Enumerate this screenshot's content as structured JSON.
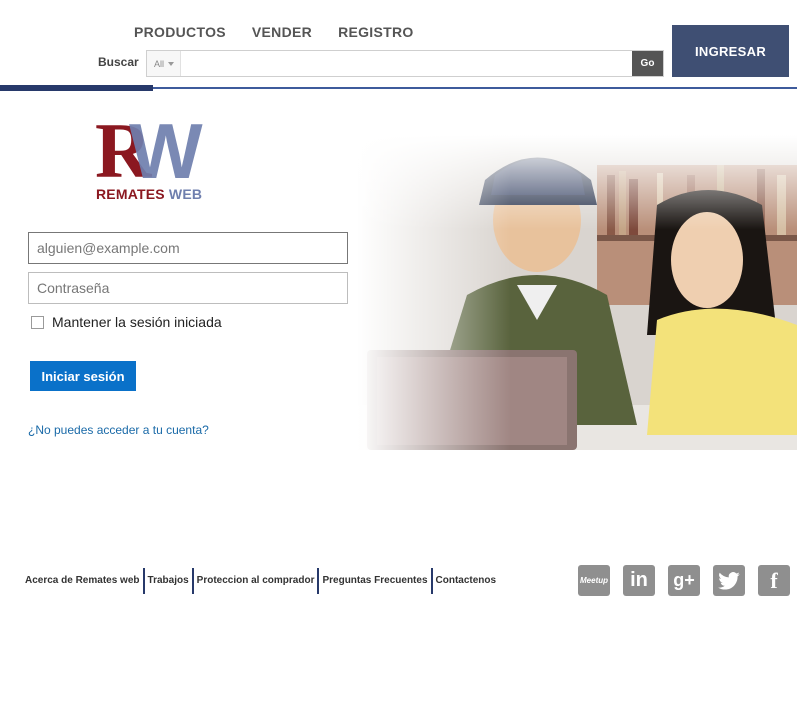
{
  "nav": {
    "items": [
      {
        "label": "PRODUCTOS"
      },
      {
        "label": "VENDER"
      },
      {
        "label": "REGISTRO"
      }
    ]
  },
  "search": {
    "label": "Buscar",
    "category": "All",
    "value": "",
    "go_label": "Go"
  },
  "header": {
    "login_button": "INGRESAR"
  },
  "logo": {
    "letter_r": "R",
    "letter_w": "W",
    "brand_1": "REMATES",
    "brand_2": " WEB"
  },
  "login": {
    "email_placeholder": "alguien@example.com",
    "password_placeholder": "Contraseña",
    "remember_label": "Mantener la sesión iniciada",
    "remember_checked": false,
    "signin_button": "Iniciar sesión",
    "forgot_link": "¿No puedes acceder a tu cuenta?"
  },
  "footer": {
    "links": [
      {
        "label": "Acerca de Remates web"
      },
      {
        "label": "Trabajos"
      },
      {
        "label": "Proteccion al comprador"
      },
      {
        "label": "Preguntas Frecuentes"
      },
      {
        "label": "Contactenos"
      }
    ],
    "social": [
      {
        "icon": "meetup-icon",
        "text": "Meetup"
      },
      {
        "icon": "linkedin-icon",
        "text": "in"
      },
      {
        "icon": "google-plus-icon",
        "text": "g+"
      },
      {
        "icon": "twitter-icon",
        "text": ""
      },
      {
        "icon": "facebook-icon",
        "text": "f"
      }
    ]
  },
  "colors": {
    "header_button": "#3f4f73",
    "accent_rule": "#27396a",
    "signin_button": "#0a71c9",
    "logo_red": "#8b1820",
    "logo_blue": "#6f7fae",
    "social_icons": "#8f8f8f"
  }
}
